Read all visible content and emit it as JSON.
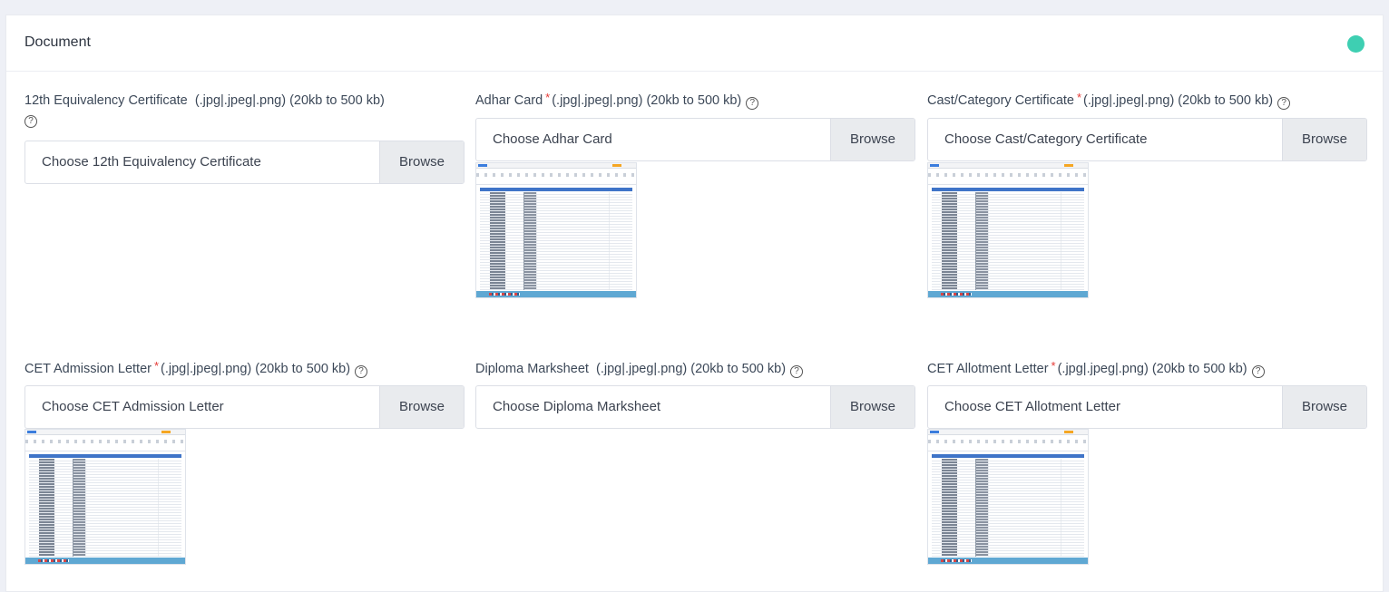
{
  "section": {
    "title": "Document",
    "status_color": "#3ecfb2"
  },
  "fields": [
    {
      "label": "12th Equivalency Certificate",
      "required": false,
      "hint": "(.jpg|.jpeg|.png)  (20kb to 500 kb)",
      "placeholder": "Choose 12th Equivalency Certificate",
      "browse": "Browse",
      "has_preview": false
    },
    {
      "label": "Adhar Card",
      "required": true,
      "required_mark": "*",
      "hint": "(.jpg|.jpeg|.png)  (20kb to 500 kb)",
      "placeholder": "Choose Adhar Card",
      "browse": "Browse",
      "has_preview": true
    },
    {
      "label": "Cast/Category Certificate",
      "required": true,
      "required_mark": "*",
      "hint": "(.jpg|.jpeg|.png)  (20kb to 500 kb)",
      "placeholder": "Choose Cast/Category Certificate",
      "browse": "Browse",
      "has_preview": true
    },
    {
      "label": "CET Admission Letter",
      "required": true,
      "required_mark": "*",
      "hint": "(.jpg|.jpeg|.png)  (20kb to 500 kb)",
      "placeholder": "Choose CET Admission Letter",
      "browse": "Browse",
      "has_preview": true
    },
    {
      "label": "Diploma Marksheet",
      "required": false,
      "hint": "(.jpg|.jpeg|.png)  (20kb to 500 kb)",
      "placeholder": "Choose Diploma Marksheet",
      "browse": "Browse",
      "has_preview": false
    },
    {
      "label": "CET Allotment Letter",
      "required": true,
      "required_mark": "*",
      "hint": "(.jpg|.jpeg|.png)  (20kb to 500 kb)",
      "placeholder": "Choose CET Allotment Letter",
      "browse": "Browse",
      "has_preview": true
    }
  ],
  "icons": {
    "help": "question-circle-icon",
    "help_glyph": "?"
  }
}
